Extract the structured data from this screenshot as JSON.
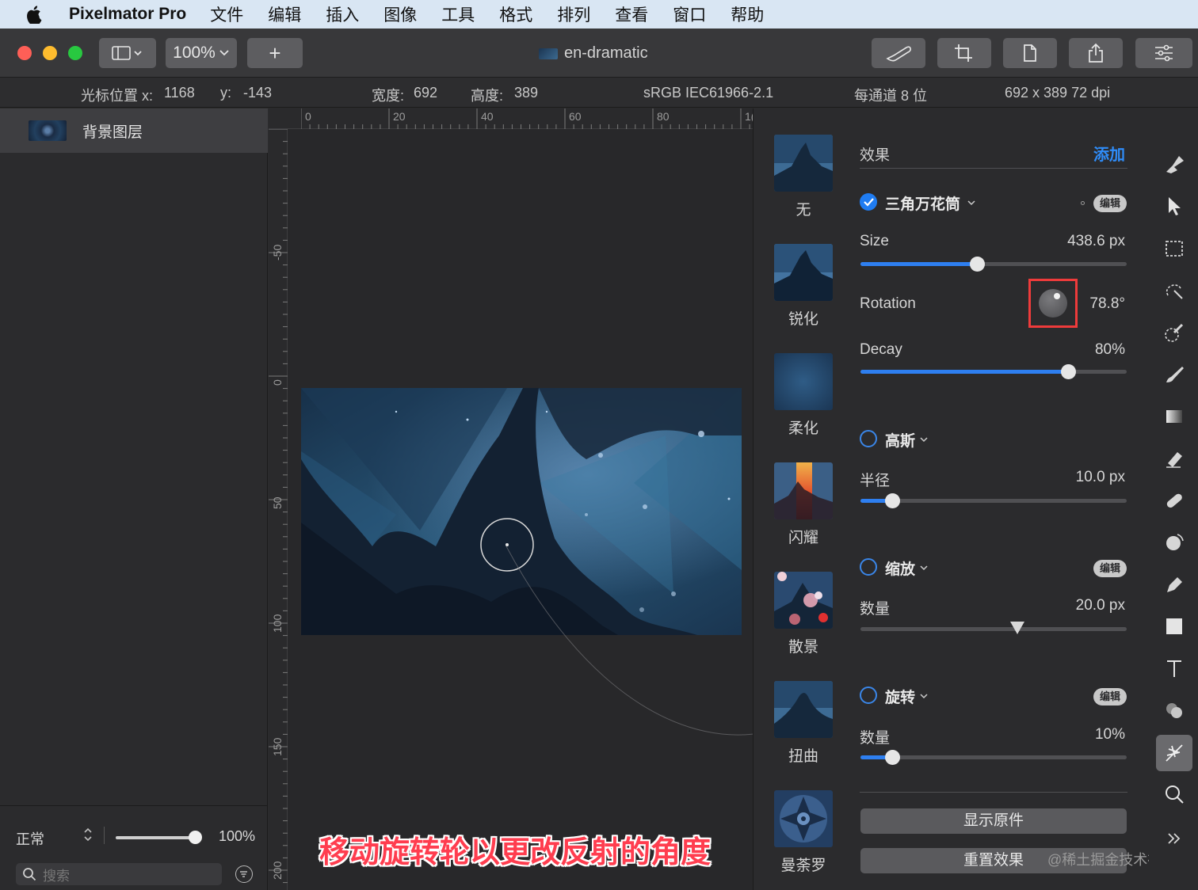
{
  "menubar": {
    "app_name": "Pixelmator Pro",
    "items": [
      "文件",
      "编辑",
      "插入",
      "图像",
      "工具",
      "格式",
      "排列",
      "查看",
      "窗口",
      "帮助"
    ]
  },
  "toolbar": {
    "zoom": "100%",
    "add_label": "+",
    "document_title": "en-dramatic"
  },
  "infobar": {
    "cursor_x_label": "光标位置 x:",
    "cursor_x": "1168",
    "cursor_y_label": "y:",
    "cursor_y": "-143",
    "width_label": "宽度:",
    "width": "692",
    "height_label": "高度:",
    "height": "389",
    "color_profile": "sRGB IEC61966-2.1",
    "bit_depth": "每通道 8 位",
    "dimensions": "692 x 389 72 dpi"
  },
  "layers": {
    "items": [
      {
        "name": "背景图层"
      }
    ],
    "blend_mode": "正常",
    "opacity": "100%",
    "search_placeholder": "搜索"
  },
  "rulers": {
    "top": [
      "0",
      "20",
      "40",
      "60",
      "80",
      "1("
    ],
    "left": [
      "-50",
      "0",
      "50",
      "100",
      "150",
      "200"
    ]
  },
  "caption": "移动旋转轮以更改反射的角度",
  "presets": [
    {
      "label": "无"
    },
    {
      "label": "锐化"
    },
    {
      "label": "柔化"
    },
    {
      "label": "闪耀"
    },
    {
      "label": "散景"
    },
    {
      "label": "扭曲"
    },
    {
      "label": "曼荼罗"
    }
  ],
  "effects": {
    "header": "效果",
    "add_label": "添加",
    "edit_badge": "编辑",
    "kaleidoscope": {
      "name": "三角万花筒",
      "enabled": true,
      "size_label": "Size",
      "size_value": "438.6 px",
      "size_fraction": 0.44,
      "rotation_label": "Rotation",
      "rotation_value": "78.8°",
      "decay_label": "Decay",
      "decay_value": "80%",
      "decay_fraction": 0.78
    },
    "gaussian": {
      "name": "高斯",
      "enabled": false,
      "radius_label": "半径",
      "radius_value": "10.0 px",
      "radius_fraction": 0.12
    },
    "zoom": {
      "name": "缩放",
      "enabled": false,
      "amount_label": "数量",
      "amount_value": "20.0 px",
      "amount_fraction": 0.59
    },
    "spin": {
      "name": "旋转",
      "enabled": false,
      "amount_label": "数量",
      "amount_value": "10%",
      "amount_fraction": 0.12
    },
    "show_original": "显示原件",
    "reset": "重置效果"
  },
  "watermark": "@稀土掘金技术社区",
  "colors": {
    "accent": "#2f8cf8",
    "highlight": "#ee3b3b",
    "caption": "#ff3d4f"
  }
}
